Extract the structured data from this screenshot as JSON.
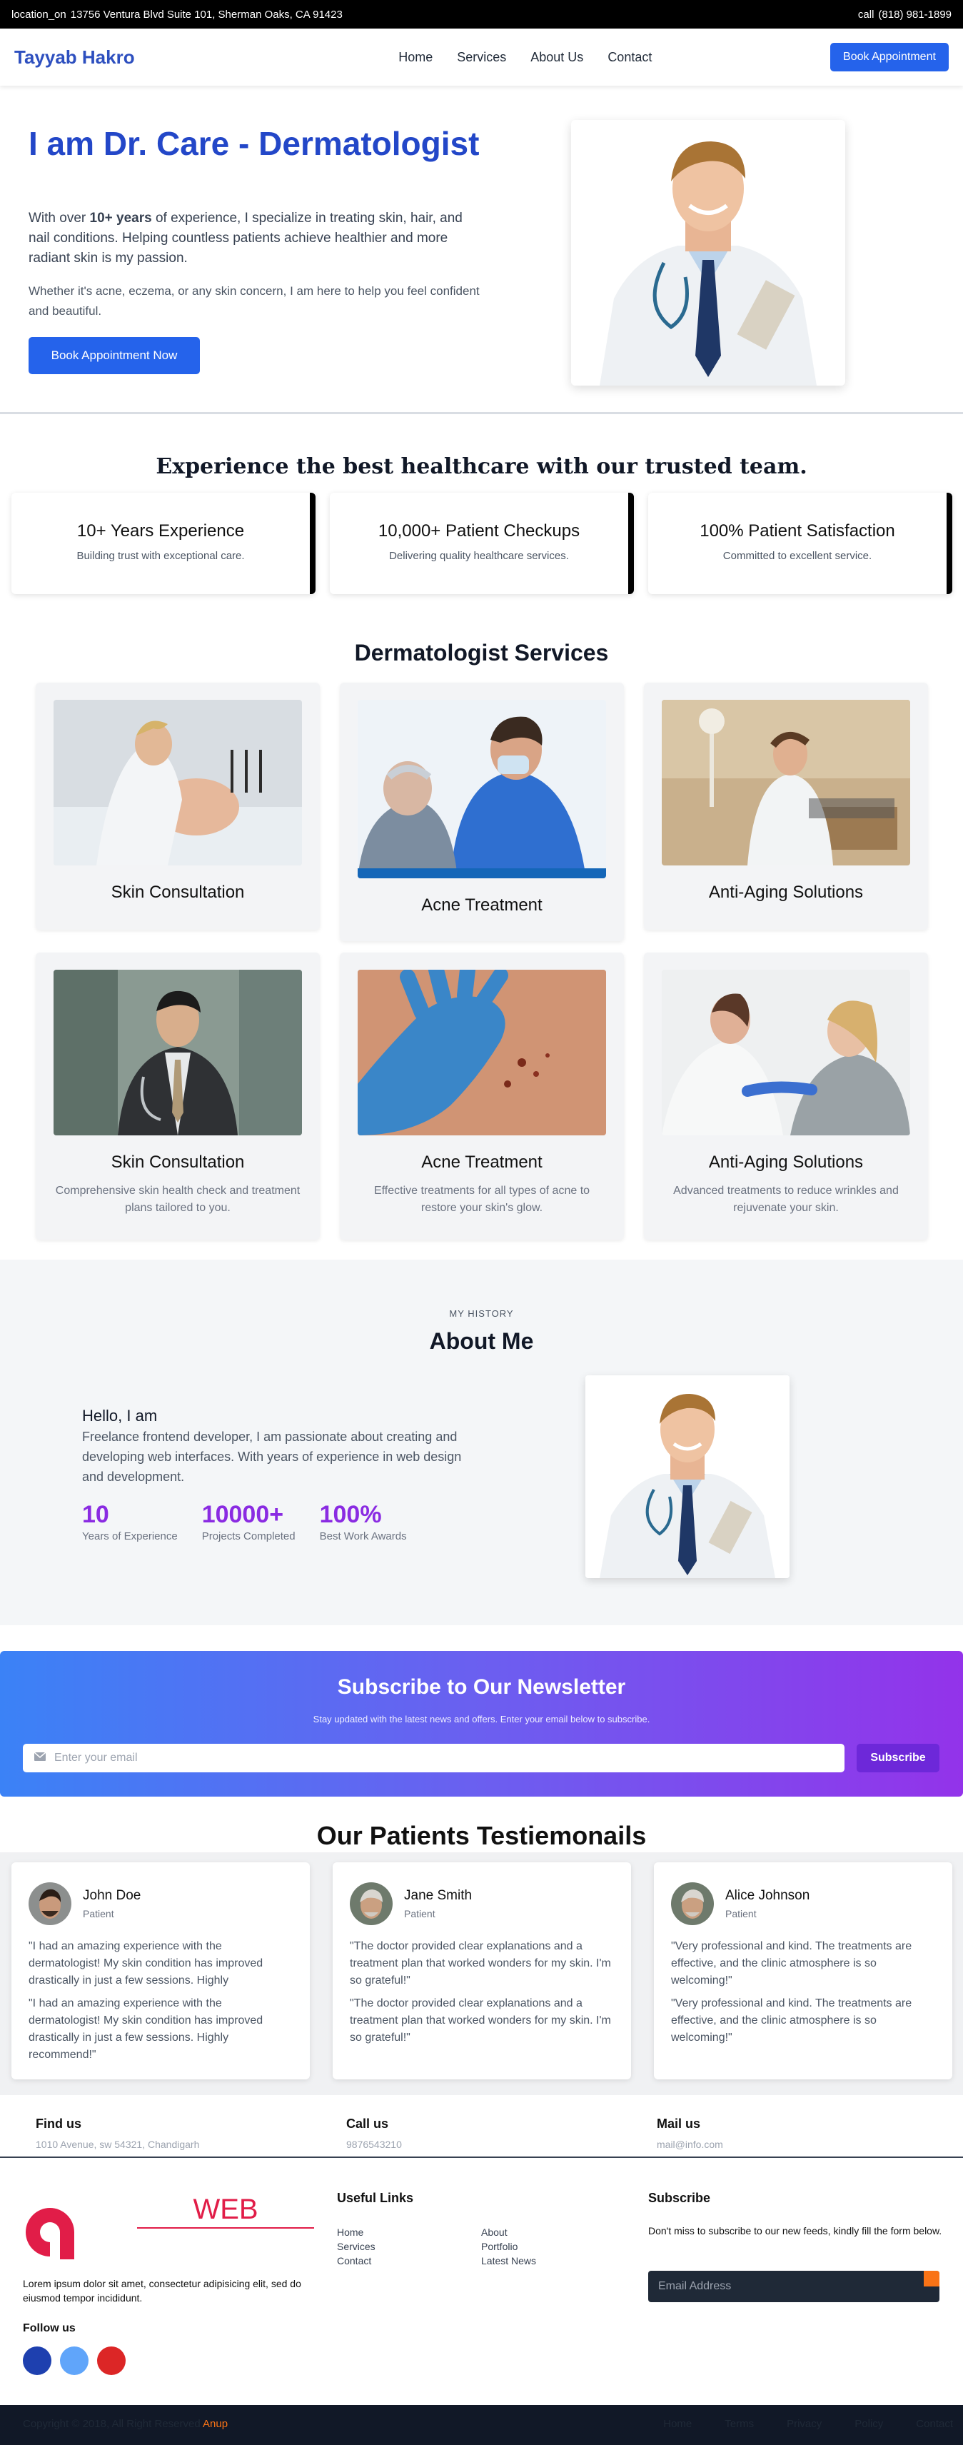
{
  "topbar": {
    "location_label": "location_on",
    "address": "13756 Ventura Blvd Suite 101, Sherman Oaks, CA 91423",
    "phone_label": "call",
    "phone": "(818) 981-1899"
  },
  "nav": {
    "brand": "Tayyab Hakro",
    "links": [
      "Home",
      "Services",
      "About Us",
      "Contact"
    ],
    "cta": "Book Appointment"
  },
  "hero": {
    "title": "I am Dr. Care - Dermatologist",
    "p1_before": "With over ",
    "p1_bold": "10+ years",
    "p1_after": " of experience, I specialize in treating skin, hair, and nail conditions. Helping countless patients achieve healthier and more radiant skin is my passion.",
    "p2": "Whether it's acne, eczema, or any skin concern, I am here to help you feel confident and beautiful.",
    "cta": "Book Appointment Now"
  },
  "experience": {
    "title": "Experience the best healthcare with our trusted team.",
    "stats": [
      {
        "title": "10+ Years Experience",
        "sub": "Building trust with exceptional care."
      },
      {
        "title": "10,000+ Patient Checkups",
        "sub": "Delivering quality healthcare services."
      },
      {
        "title": "100% Patient Satisfaction",
        "sub": "Committed to excellent service."
      }
    ]
  },
  "services": {
    "title": "Dermatologist Services",
    "items": [
      {
        "name": "Skin Consultation",
        "desc": ""
      },
      {
        "name": "Acne Treatment",
        "desc": ""
      },
      {
        "name": "Anti-Aging Solutions",
        "desc": ""
      },
      {
        "name": "Skin Consultation",
        "desc": "Comprehensive skin health check and treatment plans tailored to you."
      },
      {
        "name": "Acne Treatment",
        "desc": "Effective treatments for all types of acne to restore your skin's glow."
      },
      {
        "name": "Anti-Aging Solutions",
        "desc": "Advanced treatments to reduce wrinkles and rejuvenate your skin."
      }
    ]
  },
  "about": {
    "kicker": "MY HISTORY",
    "title": "About Me",
    "hello": "Hello, I am",
    "bio": "Freelance frontend developer, I am passionate about creating and developing web interfaces. With years of experience in web design and development.",
    "stats": [
      {
        "value": "10",
        "label": "Years of Experience"
      },
      {
        "value": "10000+",
        "label": "Projects Completed"
      },
      {
        "value": "100%",
        "label": "Best Work Awards"
      }
    ]
  },
  "newsletter": {
    "title": "Subscribe to Our Newsletter",
    "subtitle": "Stay updated with the latest news and offers. Enter your email below to subscribe.",
    "placeholder": "Enter your email",
    "button": "Subscribe"
  },
  "testimonials": {
    "title": "Our Patients Testiemonails",
    "items": [
      {
        "name": "John Doe",
        "role": "Patient",
        "q1": "\"I had an amazing experience with the dermatologist! My skin condition has improved drastically in just a few sessions. Highly",
        "q2": "\"I had an amazing experience with the dermatologist! My skin condition has improved drastically in just a few sessions. Highly recommend!\""
      },
      {
        "name": "Jane Smith",
        "role": "Patient",
        "q1": "\"The doctor provided clear explanations and a treatment plan that worked wonders for my skin. I'm so grateful!\"",
        "q2": "\"The doctor provided clear explanations and a treatment plan that worked wonders for my skin. I'm so grateful!\""
      },
      {
        "name": "Alice Johnson",
        "role": "Patient",
        "q1": "\"Very professional and kind. The treatments are effective, and the clinic atmosphere is so welcoming!\"",
        "q2": "\"Very professional and kind. The treatments are effective, and the clinic atmosphere is so welcoming!\""
      }
    ]
  },
  "contact": [
    {
      "title": "Find us",
      "value": "1010 Avenue, sw 54321, Chandigarh"
    },
    {
      "title": "Call us",
      "value": "9876543210"
    },
    {
      "title": "Mail us",
      "value": "mail@info.com"
    }
  ],
  "footer": {
    "logo_text": "WEB",
    "about": "Lorem ipsum dolor sit amet, consectetur adipisicing elit, sed do eiusmod tempor incididunt.",
    "follow": "Follow us",
    "links_title": "Useful Links",
    "links_col1": [
      "Home",
      "Services",
      "Contact"
    ],
    "links_col2": [
      "About",
      "Portfolio",
      "Latest News"
    ],
    "subscribe_title": "Subscribe",
    "subscribe_text": "Don't miss to subscribe to our new feeds, kindly fill the form below.",
    "email_placeholder": "Email Address",
    "social_colors": [
      "#1e40af",
      "#60a5fa",
      "#dc2626"
    ]
  },
  "bottom": {
    "copyright": "Copyright © 2018, All Right Reserved",
    "author": "Anup",
    "links": [
      "Home",
      "Terms",
      "Privacy",
      "Policy",
      "Contact"
    ]
  },
  "colors": {
    "primary": "#2563eb",
    "brand": "#2d4fbf",
    "accent_purple": "#8a2be2",
    "orange": "#f97316"
  }
}
